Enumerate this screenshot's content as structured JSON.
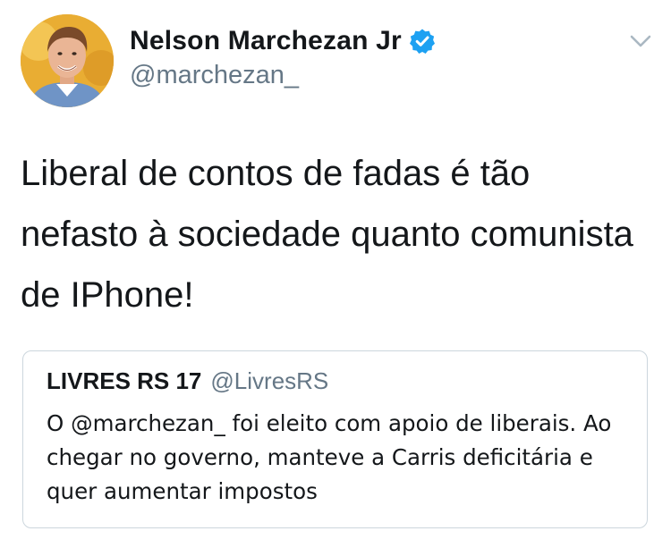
{
  "author": {
    "display_name": "Nelson Marchezan Jr",
    "handle": "@marchezan_",
    "verified": true,
    "avatar_icon": "profile-photo",
    "verified_icon": "verified-badge-icon"
  },
  "menu": {
    "icon": "chevron-down-icon"
  },
  "tweet": {
    "text": "Liberal de contos de fadas é tão nefasto à sociedade quanto comunista de IPhone!"
  },
  "quoted_tweet": {
    "display_name": "LIVRES RS 17",
    "handle": "@LivresRS",
    "text": "O @marchezan_ foi eleito com apoio de liberais. Ao chegar no governo, manteve a Carris deficitária e quer aumentar impostos"
  },
  "colors": {
    "text_primary": "#14171a",
    "text_secondary": "#657786",
    "verified_blue": "#1da1f2",
    "border": "#ccd6dd"
  }
}
